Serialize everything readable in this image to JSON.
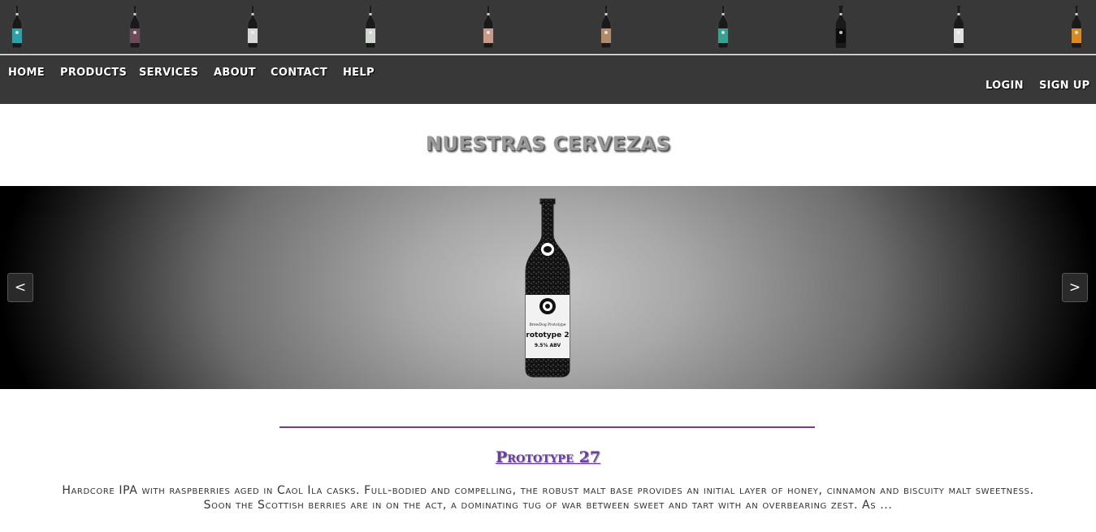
{
  "bottle_strip": {
    "bottles": [
      {
        "label_color": "#2aa3a8",
        "neck_color": "#555"
      },
      {
        "label_color": "#6b4a5a",
        "neck_color": "#555"
      },
      {
        "label_color": "#d8d8d8",
        "neck_color": "#555"
      },
      {
        "label_color": "#cfd6d0",
        "neck_color": "#555"
      },
      {
        "label_color": "#c99a88",
        "neck_color": "#555"
      },
      {
        "label_color": "#b08a6a",
        "neck_color": "#555"
      },
      {
        "label_color": "#3aa090",
        "neck_color": "#555"
      },
      {
        "label_color": "#0c0c0c",
        "neck_color": "#111"
      },
      {
        "label_color": "#e0e0e0",
        "neck_color": "#333"
      },
      {
        "label_color": "#d88a20",
        "neck_color": "#444"
      }
    ]
  },
  "nav": {
    "home": "HOME",
    "products": "PRODUCTS",
    "services": "SERVICES",
    "about": "ABOUT",
    "contact": "CONTACT",
    "help": "HELP",
    "login": "LOGIN",
    "signup": "SIGN UP"
  },
  "heading": "NUESTRAS CERVEZAS",
  "carousel": {
    "prev": "<",
    "next": ">",
    "bottle_label_small": "BrewDog Prototype",
    "bottle_label_name": "rototype 2",
    "bottle_label_abv": "9.5% ABV"
  },
  "product": {
    "title": "Prototype 27",
    "description": "Hardcore IPA with raspberries aged in Caol Ila casks. Full-bodied and compelling, the robust malt base provides an initial layer of honey, cinnamon and biscuity malt sweetness. Soon the Scottish berries are in on the act, a dominating tug of war between sweet and tart with an overbearing zest. As ..."
  },
  "colors": {
    "nav_bg": "#383838",
    "accent_purple": "#6b3fa0"
  }
}
